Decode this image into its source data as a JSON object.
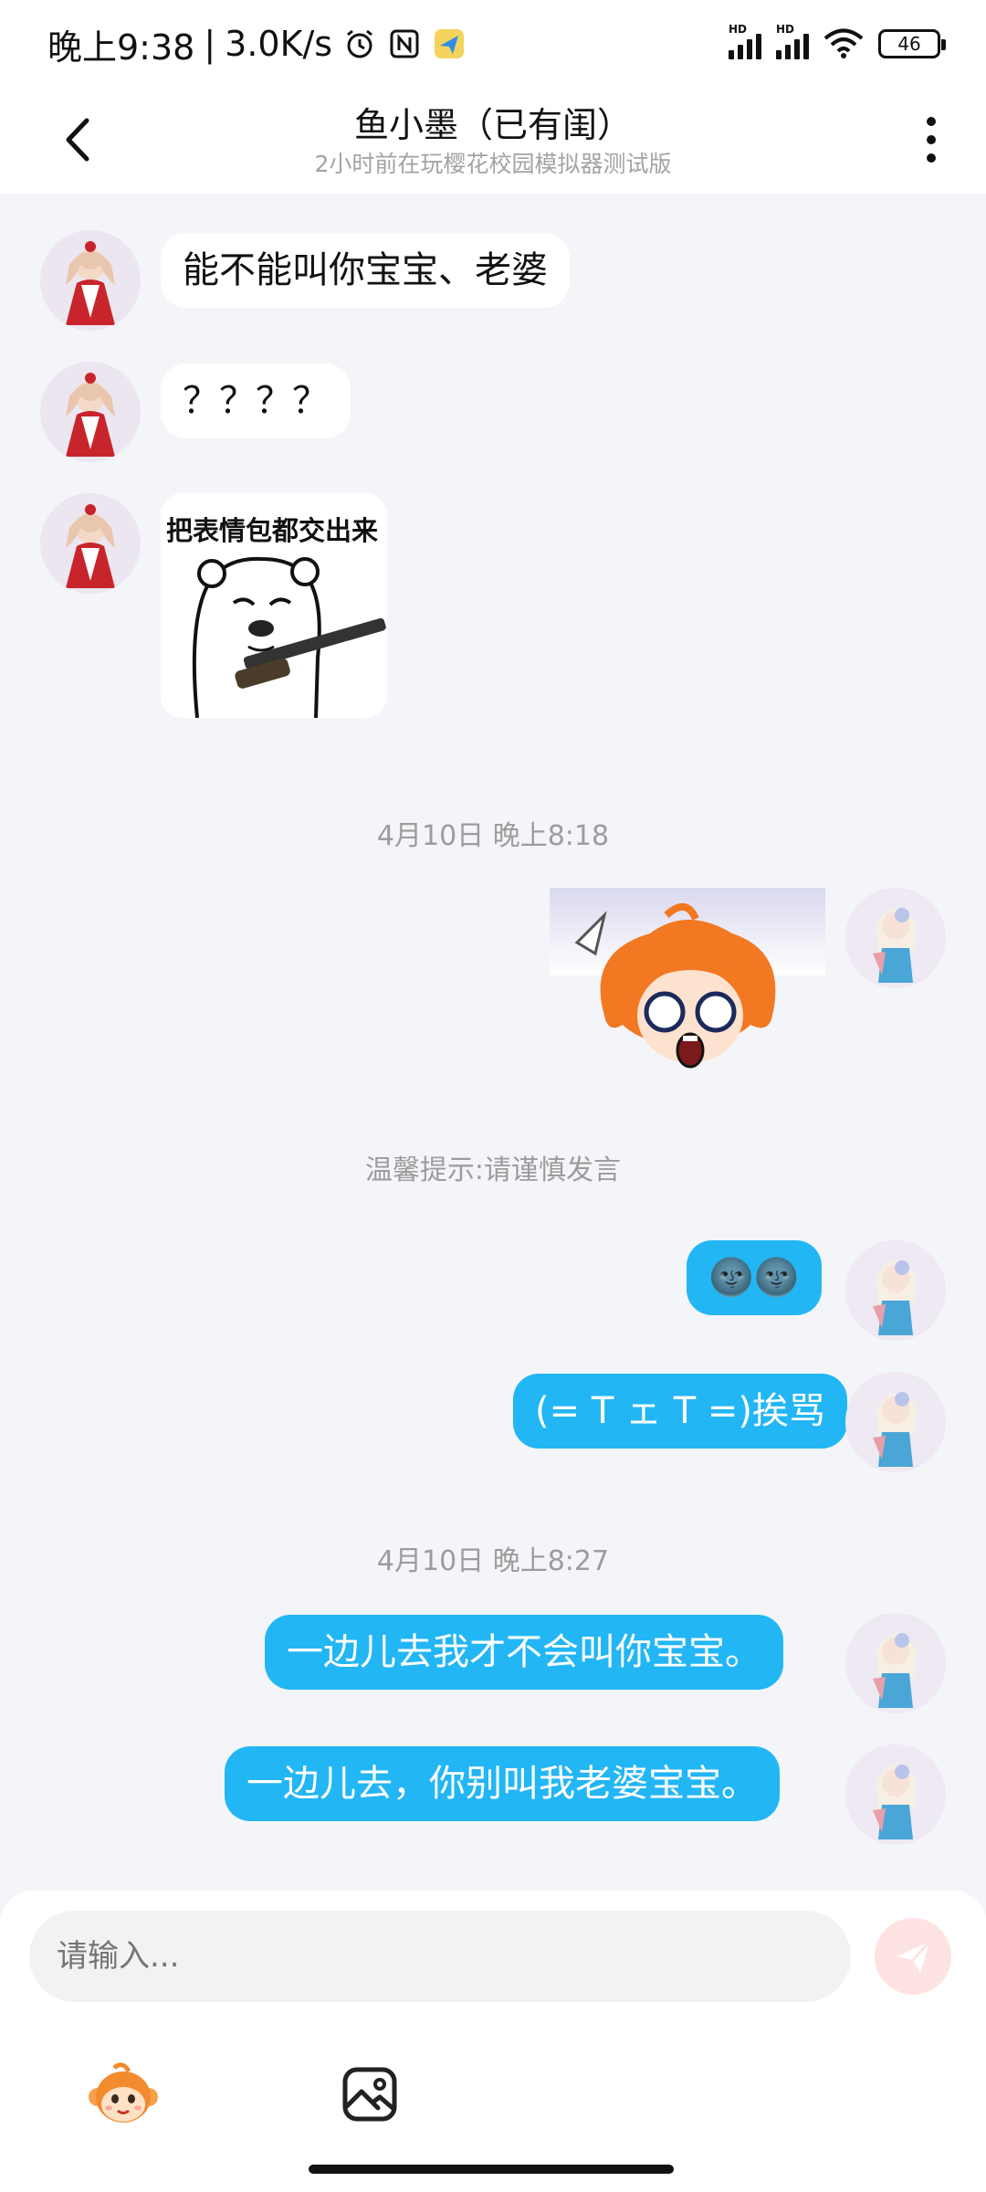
{
  "status_bar": {
    "time": "晚上9:38",
    "net_speed": "3.0K/s",
    "separator": "|",
    "hd_label": "HD",
    "battery": "46"
  },
  "header": {
    "title": "鱼小墨（已有闺）",
    "subtitle": "2小时前在玩樱花校园模拟器测试版"
  },
  "messages": [
    {
      "type": "text",
      "side": "left",
      "text": "能不能叫你宝宝、老婆"
    },
    {
      "type": "text",
      "side": "left",
      "text": "？？？？"
    },
    {
      "type": "sticker",
      "side": "left",
      "caption": "把表情包都交出来",
      "icon": "bear-with-shotgun-sticker"
    },
    {
      "type": "system",
      "text": "4月10日 晚上8:18"
    },
    {
      "type": "sticker",
      "side": "right",
      "icon": "shocked-orange-hair-sticker"
    },
    {
      "type": "system",
      "text": "温馨提示:请谨慎发言"
    },
    {
      "type": "text",
      "side": "right",
      "text": "🌚🌚"
    },
    {
      "type": "text",
      "side": "right",
      "text": "(= T ェ T =)挨骂"
    },
    {
      "type": "system",
      "text": "4月10日 晚上8:27"
    },
    {
      "type": "text",
      "side": "right",
      "text": "一边儿去我才不会叫你宝宝。"
    },
    {
      "type": "text",
      "side": "right",
      "text": "一边儿去，你别叫我老婆宝宝。"
    }
  ],
  "input": {
    "placeholder": "请输入..."
  },
  "icons": {
    "back": "back-arrow-icon",
    "more": "more-vertical-icon",
    "send": "send-icon",
    "sticker": "sticker-monkey-icon",
    "image": "image-icon"
  },
  "colors": {
    "outgoing_bubble": "#23b6f4",
    "incoming_bubble": "#ffffff",
    "chat_background": "#f4f5f9",
    "send_button": "#fde3e1"
  }
}
